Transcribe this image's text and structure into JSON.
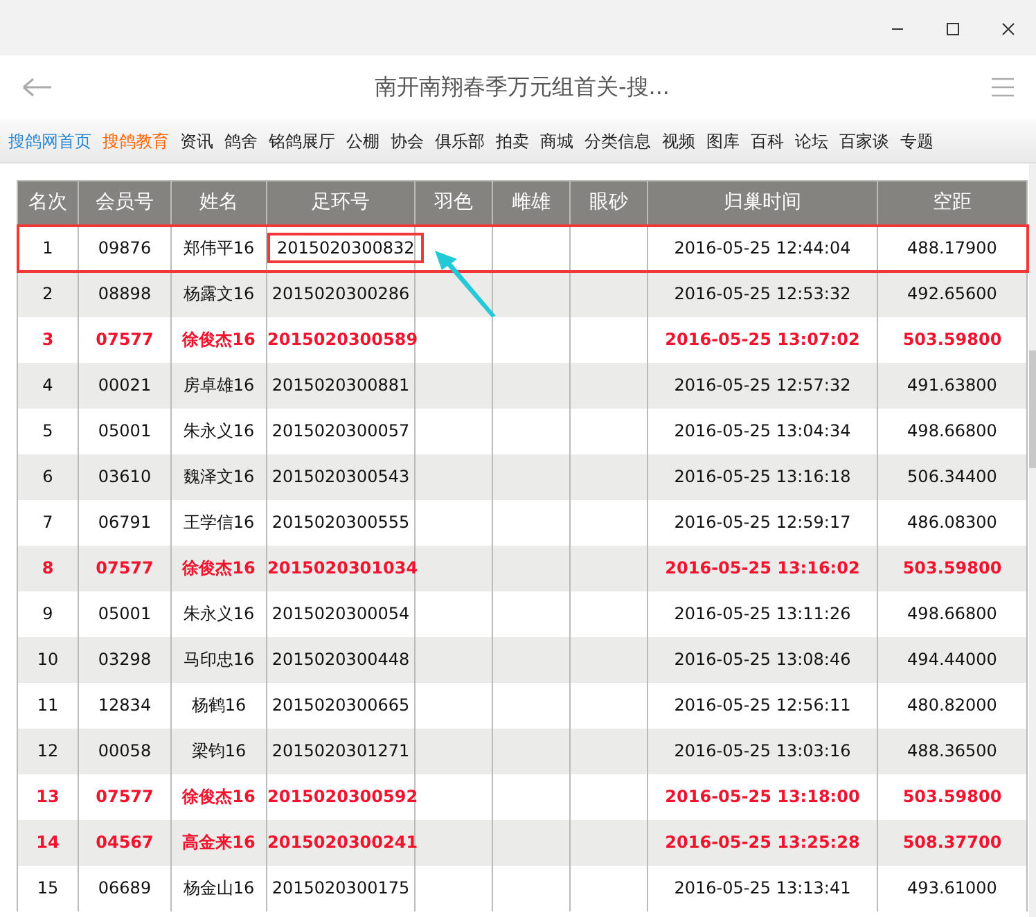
{
  "window": {
    "title": "南开南翔春季万元组首关-搜..."
  },
  "nav": [
    {
      "label": "搜鸽网首页",
      "color": "#2a8ad4"
    },
    {
      "label": "搜鸽教育",
      "color": "#ff6600"
    },
    {
      "label": "资讯",
      "color": "#222222"
    },
    {
      "label": "鸽舍",
      "color": "#222222"
    },
    {
      "label": "铭鸽展厅",
      "color": "#222222"
    },
    {
      "label": "公棚",
      "color": "#222222"
    },
    {
      "label": "协会",
      "color": "#222222"
    },
    {
      "label": "俱乐部",
      "color": "#222222"
    },
    {
      "label": "拍卖",
      "color": "#222222"
    },
    {
      "label": "商城",
      "color": "#222222"
    },
    {
      "label": "分类信息",
      "color": "#222222"
    },
    {
      "label": "视频",
      "color": "#222222"
    },
    {
      "label": "图库",
      "color": "#222222"
    },
    {
      "label": "百科",
      "color": "#222222"
    },
    {
      "label": "论坛",
      "color": "#222222"
    },
    {
      "label": "百家谈",
      "color": "#222222"
    },
    {
      "label": "专题",
      "color": "#222222"
    }
  ],
  "table": {
    "columns": [
      "名次",
      "会员号",
      "姓名",
      "足环号",
      "羽色",
      "雌雄",
      "眼砂",
      "归巢时间",
      "空距"
    ],
    "rows": [
      {
        "cells": [
          "1",
          "09876",
          "郑伟平16",
          "2015020300832",
          "",
          "",
          "",
          "2016-05-25 12:44:04",
          "488.17900"
        ],
        "highlight": false,
        "boxed": true
      },
      {
        "cells": [
          "2",
          "08898",
          "杨露文16",
          "2015020300286",
          "",
          "",
          "",
          "2016-05-25 12:53:32",
          "492.65600"
        ],
        "highlight": false,
        "boxed": false
      },
      {
        "cells": [
          "3",
          "07577",
          "徐俊杰16",
          "2015020300589",
          "",
          "",
          "",
          "2016-05-25 13:07:02",
          "503.59800"
        ],
        "highlight": true,
        "boxed": false
      },
      {
        "cells": [
          "4",
          "00021",
          "房卓雄16",
          "2015020300881",
          "",
          "",
          "",
          "2016-05-25 12:57:32",
          "491.63800"
        ],
        "highlight": false,
        "boxed": false
      },
      {
        "cells": [
          "5",
          "05001",
          "朱永义16",
          "2015020300057",
          "",
          "",
          "",
          "2016-05-25 13:04:34",
          "498.66800"
        ],
        "highlight": false,
        "boxed": false
      },
      {
        "cells": [
          "6",
          "03610",
          "魏泽文16",
          "2015020300543",
          "",
          "",
          "",
          "2016-05-25 13:16:18",
          "506.34400"
        ],
        "highlight": false,
        "boxed": false
      },
      {
        "cells": [
          "7",
          "06791",
          "王学信16",
          "2015020300555",
          "",
          "",
          "",
          "2016-05-25 12:59:17",
          "486.08300"
        ],
        "highlight": false,
        "boxed": false
      },
      {
        "cells": [
          "8",
          "07577",
          "徐俊杰16",
          "2015020301034",
          "",
          "",
          "",
          "2016-05-25 13:16:02",
          "503.59800"
        ],
        "highlight": true,
        "boxed": false
      },
      {
        "cells": [
          "9",
          "05001",
          "朱永义16",
          "2015020300054",
          "",
          "",
          "",
          "2016-05-25 13:11:26",
          "498.66800"
        ],
        "highlight": false,
        "boxed": false
      },
      {
        "cells": [
          "10",
          "03298",
          "马印忠16",
          "2015020300448",
          "",
          "",
          "",
          "2016-05-25 13:08:46",
          "494.44000"
        ],
        "highlight": false,
        "boxed": false
      },
      {
        "cells": [
          "11",
          "12834",
          "杨鹤16",
          "2015020300665",
          "",
          "",
          "",
          "2016-05-25 12:56:11",
          "480.82000"
        ],
        "highlight": false,
        "boxed": false
      },
      {
        "cells": [
          "12",
          "00058",
          "梁钧16",
          "2015020301271",
          "",
          "",
          "",
          "2016-05-25 13:03:16",
          "488.36500"
        ],
        "highlight": false,
        "boxed": false
      },
      {
        "cells": [
          "13",
          "07577",
          "徐俊杰16",
          "2015020300592",
          "",
          "",
          "",
          "2016-05-25 13:18:00",
          "503.59800"
        ],
        "highlight": true,
        "boxed": false
      },
      {
        "cells": [
          "14",
          "04567",
          "高金来16",
          "2015020300241",
          "",
          "",
          "",
          "2016-05-25 13:25:28",
          "508.37700"
        ],
        "highlight": true,
        "boxed": false
      },
      {
        "cells": [
          "15",
          "06689",
          "杨金山16",
          "2015020300175",
          "",
          "",
          "",
          "2016-05-25 13:13:41",
          "493.61000"
        ],
        "highlight": false,
        "boxed": false
      }
    ]
  }
}
